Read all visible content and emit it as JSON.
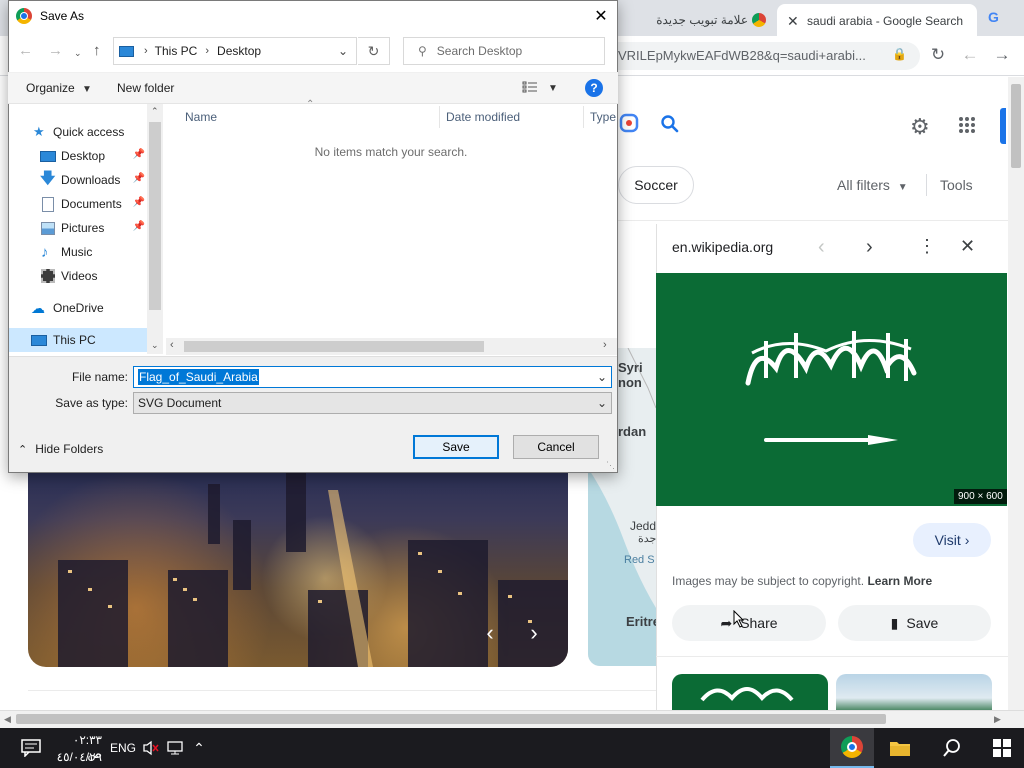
{
  "browser": {
    "tabs": [
      {
        "title": "علامة تبويب جديدة",
        "active": false
      },
      {
        "title": "saudi arabia - Google Search",
        "active": true
      }
    ],
    "url": "VRILEpMykwEAFdWB28&q=saudi+arabi..."
  },
  "google": {
    "chip_label": "Soccer",
    "all_filters": "All filters",
    "tools": "Tools",
    "map_labels": [
      "Syri",
      "non",
      "rdan",
      "Jedd",
      "جدة",
      "Red S",
      "Eritre"
    ]
  },
  "panel": {
    "source": "en.wikipedia.org",
    "dims": "900 × 600",
    "visit": "Visit",
    "copyright": "Images may be subject to copyright.",
    "learn_more": "Learn More",
    "share": "Share",
    "save": "Save"
  },
  "dialog": {
    "title": "Save As",
    "breadcrumb": [
      "This PC",
      "Desktop"
    ],
    "search_placeholder": "Search Desktop",
    "organize": "Organize",
    "new_folder": "New folder",
    "nav_items": [
      {
        "label": "Quick access",
        "icon": "star-icon",
        "pinned": false
      },
      {
        "label": "Desktop",
        "icon": "desktop-icon",
        "pinned": true
      },
      {
        "label": "Downloads",
        "icon": "download-icon",
        "pinned": true
      },
      {
        "label": "Documents",
        "icon": "document-icon",
        "pinned": true
      },
      {
        "label": "Pictures",
        "icon": "pictures-icon",
        "pinned": true
      },
      {
        "label": "Music",
        "icon": "music-icon",
        "pinned": false
      },
      {
        "label": "Videos",
        "icon": "videos-icon",
        "pinned": false
      },
      {
        "label": "OneDrive",
        "icon": "cloud-icon",
        "pinned": false
      },
      {
        "label": "This PC",
        "icon": "pc-icon",
        "pinned": false
      }
    ],
    "columns": [
      "Name",
      "Date modified",
      "Type"
    ],
    "empty_message": "No items match your search.",
    "file_name_label": "File name:",
    "file_name": "Flag_of_Saudi_Arabia",
    "save_type_label": "Save as type:",
    "save_type": "SVG Document",
    "hide_folders": "Hide Folders",
    "save_button": "Save",
    "cancel_button": "Cancel"
  },
  "taskbar": {
    "lang": "ENG",
    "time": "٠٢:٣٣ ص",
    "date": "٤٥/٠٤/٢٩"
  },
  "colors": {
    "accent": "#0078d7",
    "flag_green": "#0b6b35",
    "google_blue": "#1a73e8"
  }
}
